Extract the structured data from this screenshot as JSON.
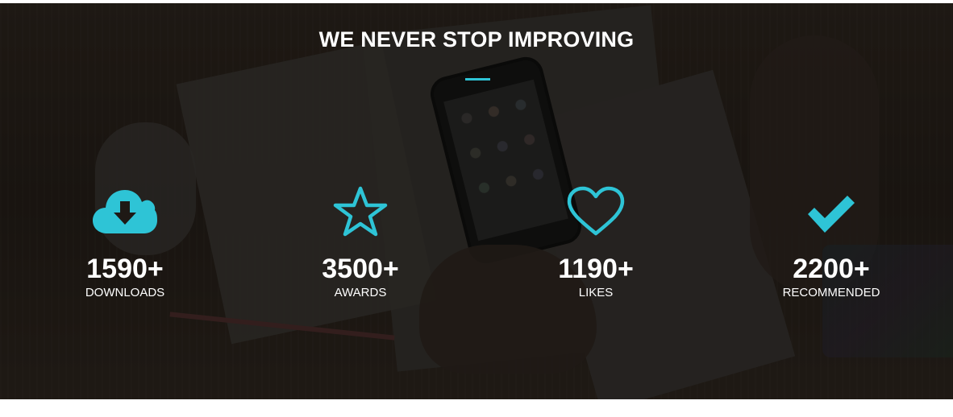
{
  "section": {
    "heading": "WE NEVER STOP IMPROVING",
    "accent_color": "#2ec4d6"
  },
  "stats": [
    {
      "icon": "cloud-download-icon",
      "value": "1590+",
      "label": "DOWNLOADS"
    },
    {
      "icon": "star-icon",
      "value": "3500+",
      "label": "AWARDS"
    },
    {
      "icon": "heart-icon",
      "value": "1190+",
      "label": "LIKES"
    },
    {
      "icon": "checkmark-icon",
      "value": "2200+",
      "label": "RECOMMENDED"
    }
  ]
}
